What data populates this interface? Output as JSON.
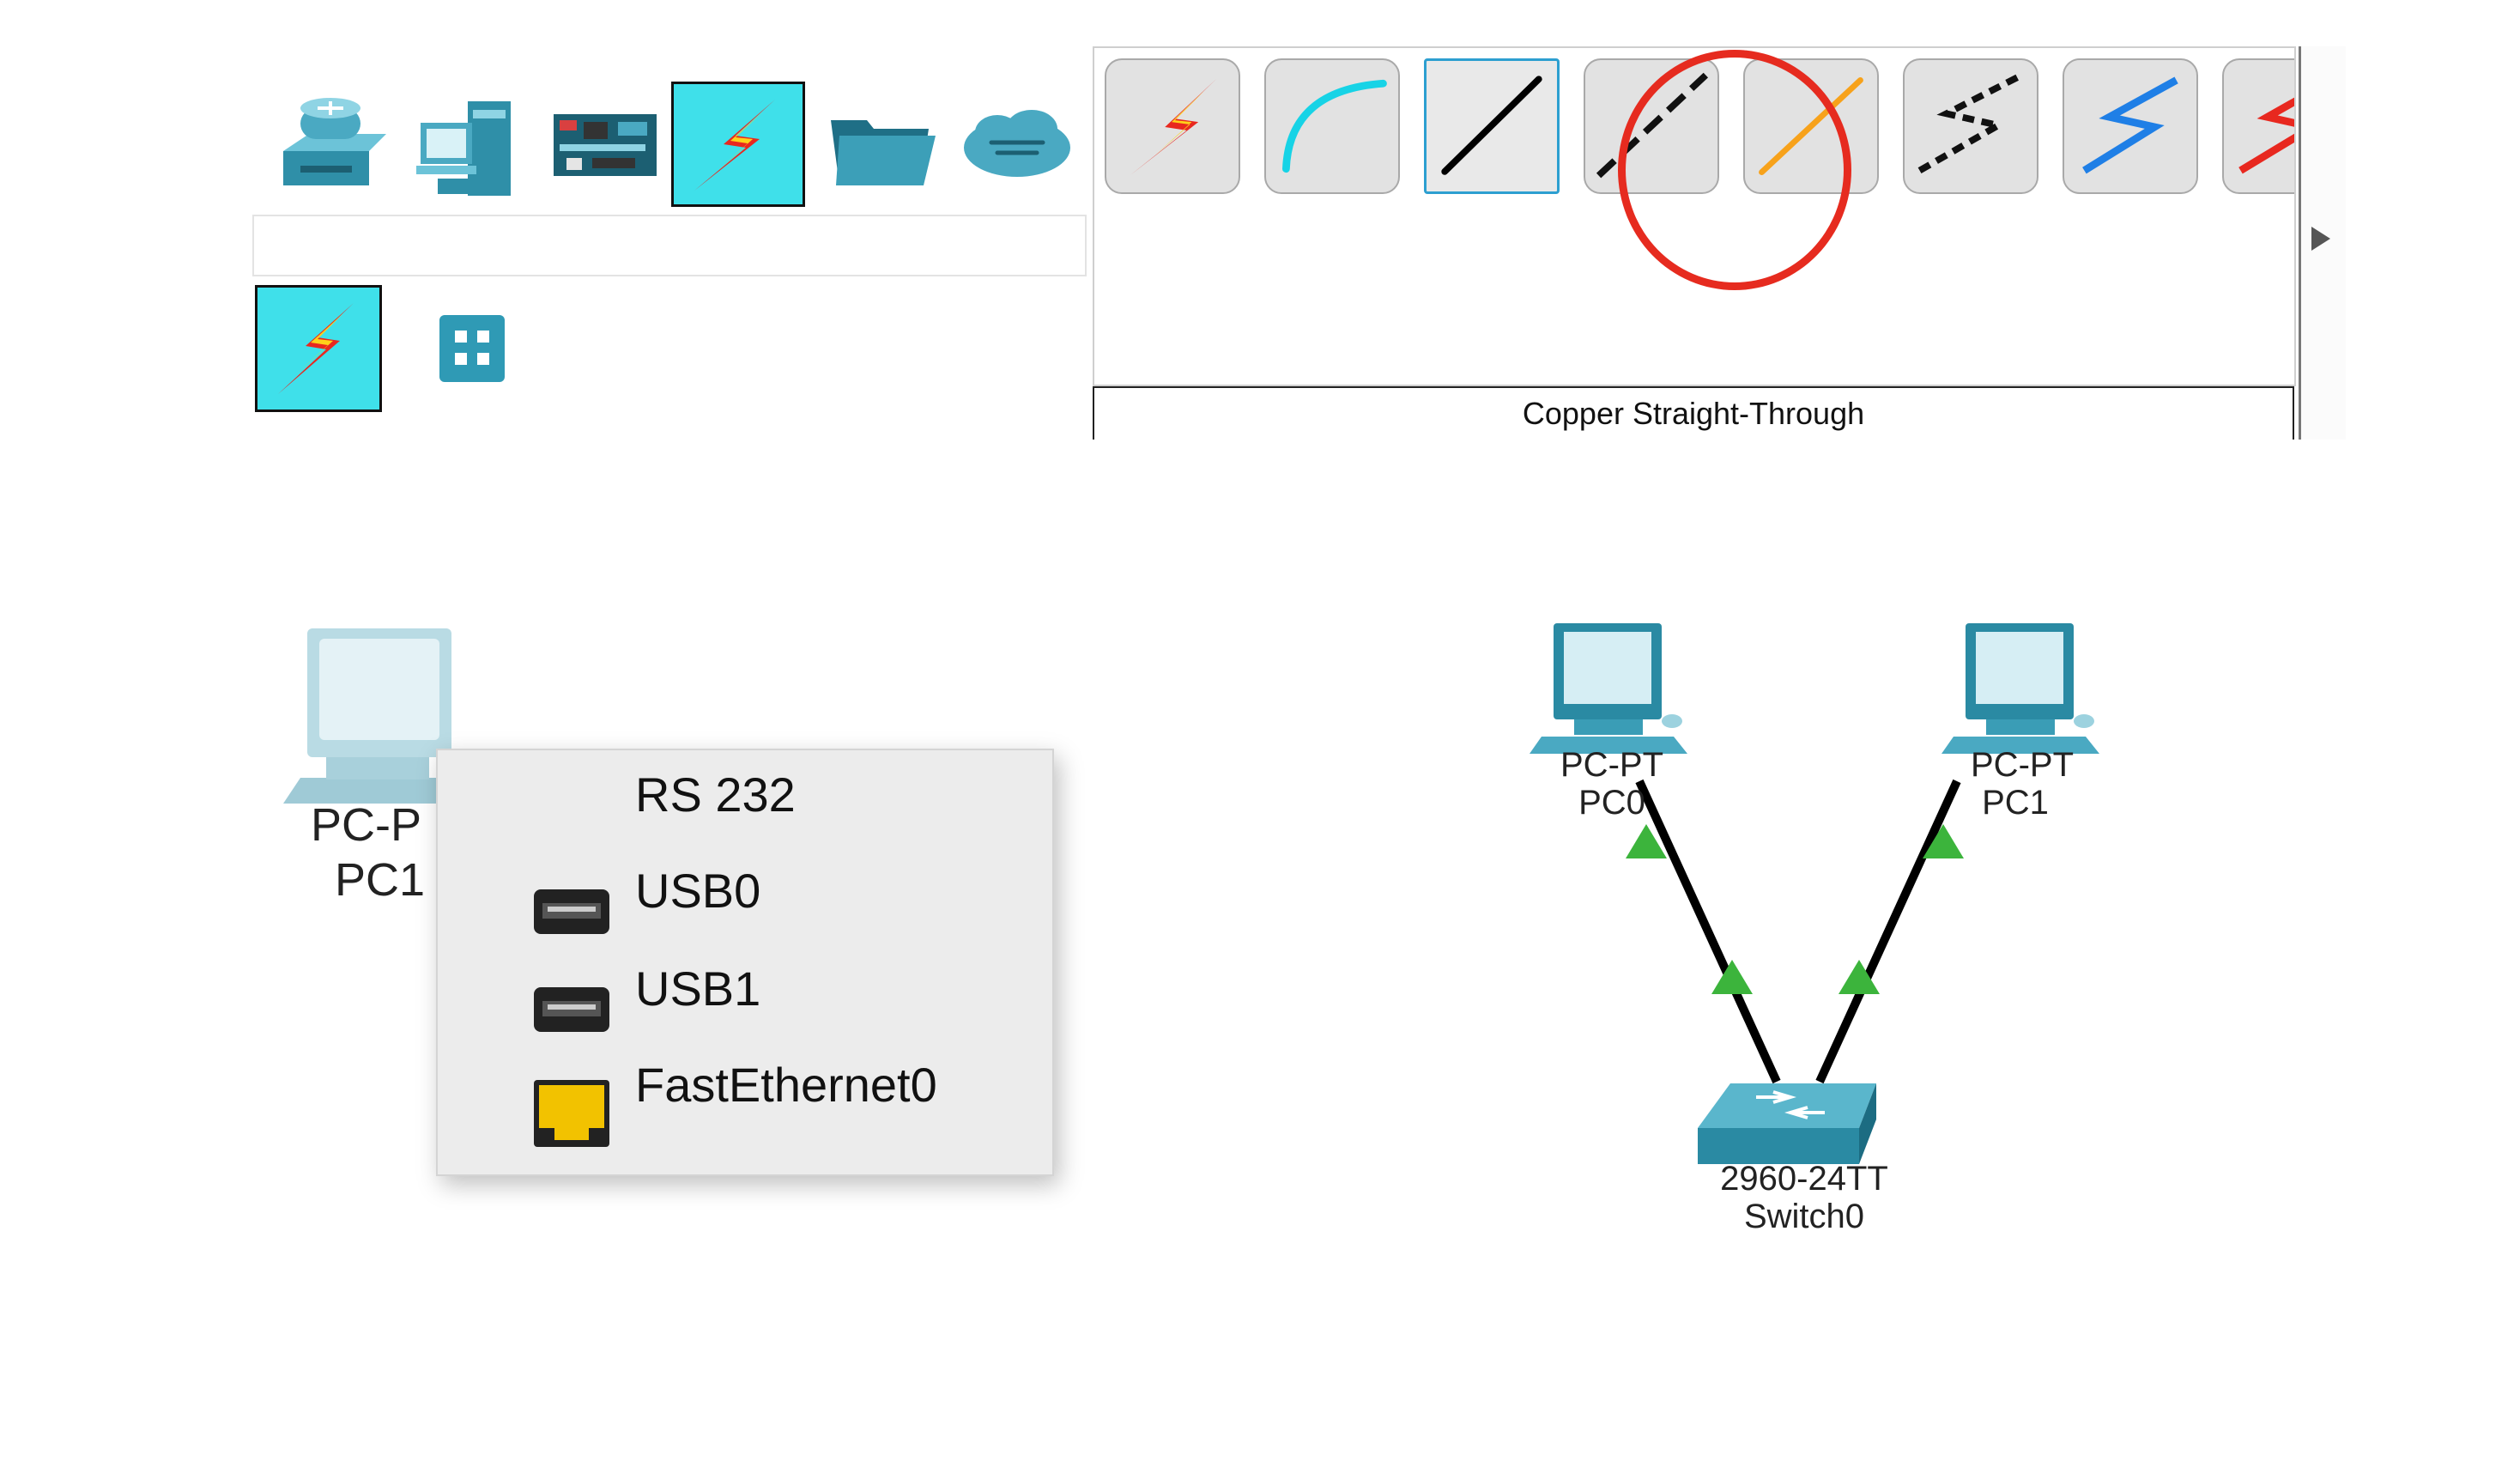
{
  "toolbar": {
    "categories": [
      {
        "name": "network-devices-icon"
      },
      {
        "name": "end-devices-icon"
      },
      {
        "name": "components-icon"
      },
      {
        "name": "connections-icon",
        "selected": true
      },
      {
        "name": "miscellaneous-icon"
      },
      {
        "name": "multiuser-connection-icon"
      }
    ],
    "subcategories": [
      {
        "name": "connections-subcategory-icon",
        "selected": true
      },
      {
        "name": "grid-icon"
      }
    ],
    "cables": [
      {
        "name": "automatic-connection-cable"
      },
      {
        "name": "console-cable"
      },
      {
        "name": "copper-straight-through-cable",
        "selected": true
      },
      {
        "name": "copper-cross-over-cable"
      },
      {
        "name": "fiber-cable"
      },
      {
        "name": "phone-cable"
      },
      {
        "name": "coaxial-cable"
      },
      {
        "name": "serial-cable"
      }
    ],
    "selected_cable_label": "Copper Straight-Through"
  },
  "left_device": {
    "type_label": "PC-P",
    "name_label": "PC1"
  },
  "port_menu": {
    "items": [
      {
        "label": "RS 232",
        "icon": "none"
      },
      {
        "label": "USB0",
        "icon": "usb-port-icon"
      },
      {
        "label": "USB1",
        "icon": "usb-port-icon"
      },
      {
        "label": "FastEthernet0",
        "icon": "ethernet-port-icon"
      }
    ]
  },
  "topology": {
    "pc0": {
      "type": "PC-PT",
      "name": "PC0"
    },
    "pc1": {
      "type": "PC-PT",
      "name": "PC1"
    },
    "switch": {
      "model": "2960-24TT",
      "name": "Switch0"
    },
    "link_status_color": "#3cb43c"
  },
  "colors": {
    "highlight": "#e62b1f",
    "connection_selected_bg": "#3fe0ea",
    "ethernet_port": "#f2c200"
  }
}
